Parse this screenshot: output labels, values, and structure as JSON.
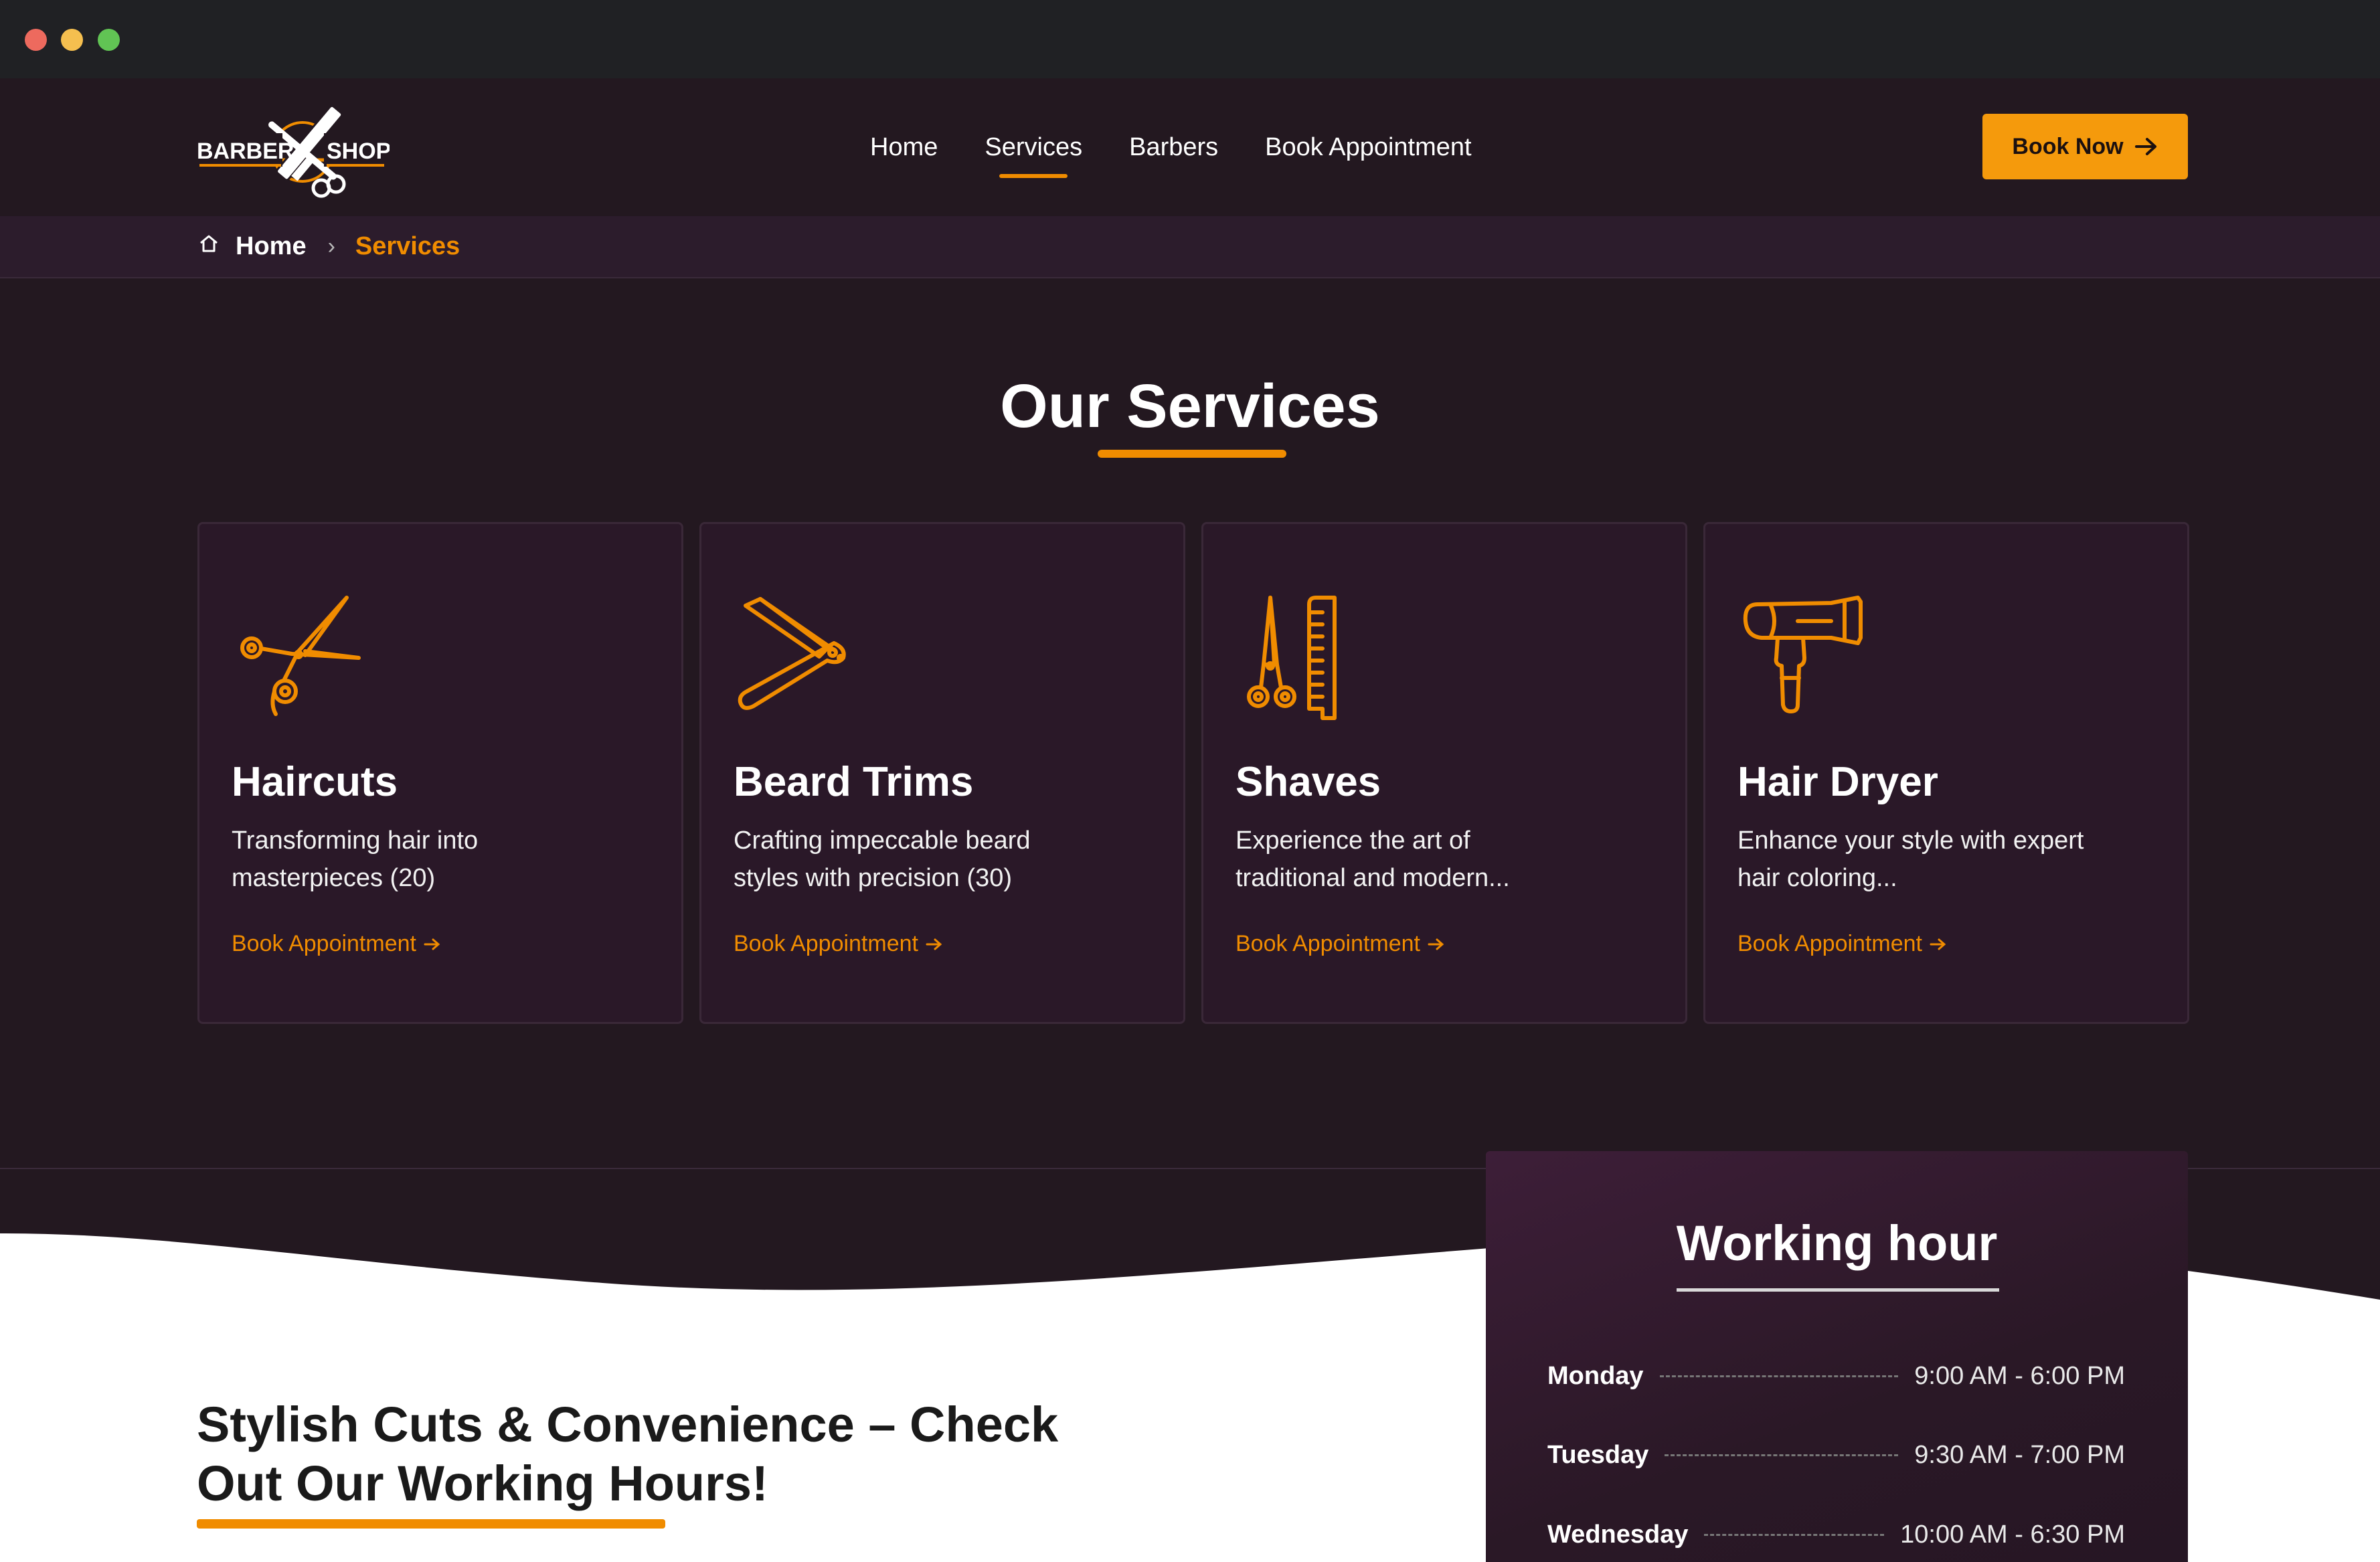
{
  "colors": {
    "accent": "#f08c00",
    "background": "#231820",
    "card": "#2a1828"
  },
  "logo": {
    "left_text": "BARBER",
    "right_text": "SHOP"
  },
  "nav": {
    "items": [
      {
        "label": "Home"
      },
      {
        "label": "Services",
        "active": true
      },
      {
        "label": "Barbers"
      },
      {
        "label": "Book Appointment"
      }
    ],
    "cta": "Book Now"
  },
  "breadcrumb": {
    "home": "Home",
    "current": "Services"
  },
  "services": {
    "title": "Our Services",
    "cards": [
      {
        "icon": "scissors-icon",
        "title": "Haircuts",
        "desc": "Transforming hair into masterpieces (20)",
        "link": "Book Appointment"
      },
      {
        "icon": "razor-icon",
        "title": "Beard Trims",
        "desc": "Crafting impeccable beard styles with precision (30)",
        "link": "Book Appointment"
      },
      {
        "icon": "scissors-comb-icon",
        "title": "Shaves",
        "desc": "Experience the art of traditional and modern...",
        "link": "Book Appointment"
      },
      {
        "icon": "hair-dryer-icon",
        "title": "Hair Dryer",
        "desc": "Enhance your style with expert hair coloring...",
        "link": "Book Appointment"
      }
    ]
  },
  "hours_section": {
    "heading": "Stylish Cuts & Convenience – Check Out Our Working Hours!"
  },
  "working_hours": {
    "title": "Working hour",
    "rows": [
      {
        "day": "Monday",
        "time": "9:00 AM - 6:00 PM"
      },
      {
        "day": "Tuesday",
        "time": "9:30 AM - 7:00 PM"
      },
      {
        "day": "Wednesday",
        "time": "10:00 AM - 6:30 PM"
      }
    ]
  }
}
